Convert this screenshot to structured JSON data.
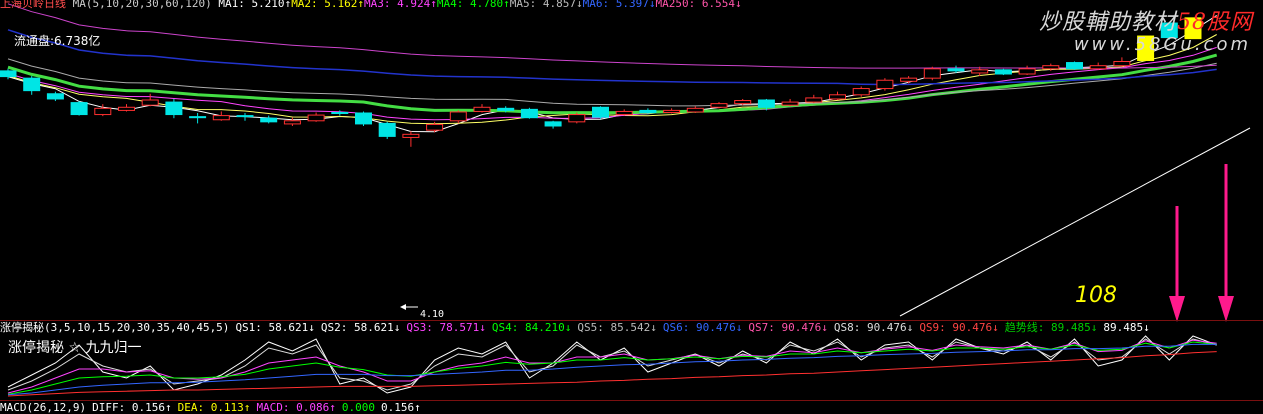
{
  "header": {
    "stock_title": "上海贝岭日线",
    "ma_params": "MA(5,10,20,30,60,120)",
    "ma_values": [
      {
        "label": "MA1: 5.210↑",
        "color": "#ffffff"
      },
      {
        "label": "MA2: 5.162↑",
        "color": "#ffff00"
      },
      {
        "label": "MA3: 4.924↑",
        "color": "#ff44ff"
      },
      {
        "label": "MA4: 4.780↑",
        "color": "#00ff00"
      },
      {
        "label": "MA5: 4.857↓",
        "color": "#bbbbbb"
      },
      {
        "label": "MA6: 5.397↓",
        "color": "#3366ff"
      },
      {
        "label": "MA250: 6.554↓",
        "color": "#ff55aa"
      }
    ]
  },
  "float_share": "流通盘:6.738亿",
  "low_label": "4.10",
  "annotation": "108",
  "watermark": {
    "line1_prefix": "炒股輔助教材",
    "line1_brand": "58股网",
    "line2": "www.58Gu.com"
  },
  "indicator": {
    "title": "涨停揭秘(3,5,10,15,20,30,35,40,45,5)",
    "values": [
      {
        "label": "QS1: 58.621↓",
        "color": "#ffffff"
      },
      {
        "label": "QS2: 58.621↓",
        "color": "#ffffff"
      },
      {
        "label": "QS3: 78.571↓",
        "color": "#ff44ff"
      },
      {
        "label": "QS4: 84.210↓",
        "color": "#00ff00"
      },
      {
        "label": "QS5: 85.542↓",
        "color": "#bbbbbb"
      },
      {
        "label": "QS6: 90.476↓",
        "color": "#3366ff"
      },
      {
        "label": "QS7: 90.476↓",
        "color": "#ff55aa"
      },
      {
        "label": "QS8: 90.476↓",
        "color": "#dddddd"
      },
      {
        "label": "QS9: 90.476↓",
        "color": "#ff4444"
      },
      {
        "label": "趋势线: 89.485↓",
        "color": "#00cc00"
      },
      {
        "label": "89.485↓",
        "color": "#ffffff"
      }
    ],
    "subtitle": "涨停揭秘 ☆ 九九归一"
  },
  "macd": {
    "params": "MACD(26,12,9)",
    "values": [
      {
        "label": "DIFF: 0.156↑",
        "color": "#ffffff"
      },
      {
        "label": "DEA: 0.113↑",
        "color": "#ffff00"
      },
      {
        "label": "MACD: 0.086↑",
        "color": "#ff44ff"
      },
      {
        "label": "0.000",
        "color": "#00ff00"
      },
      {
        "label": "0.156↑",
        "color": "#ffffff"
      }
    ]
  },
  "colors": {
    "up": "#ff3030",
    "down": "#00e5e5",
    "limit_up": "#ffff00",
    "arrow": "#ff1a8c"
  },
  "candles": [
    {
      "o": 5.56,
      "c": 5.45,
      "h": 5.6,
      "l": 5.4
    },
    {
      "o": 5.42,
      "c": 5.18,
      "h": 5.46,
      "l": 5.1
    },
    {
      "o": 5.12,
      "c": 5.02,
      "h": 5.16,
      "l": 4.98
    },
    {
      "o": 4.95,
      "c": 4.72,
      "h": 4.98,
      "l": 4.7
    },
    {
      "o": 4.72,
      "c": 4.84,
      "h": 4.92,
      "l": 4.69
    },
    {
      "o": 4.8,
      "c": 4.86,
      "h": 4.92,
      "l": 4.78
    },
    {
      "o": 4.9,
      "c": 5.0,
      "h": 5.12,
      "l": 4.88
    },
    {
      "o": 4.96,
      "c": 4.72,
      "h": 5.02,
      "l": 4.65
    },
    {
      "o": 4.68,
      "c": 4.66,
      "h": 4.75,
      "l": 4.55
    },
    {
      "o": 4.62,
      "c": 4.7,
      "h": 4.78,
      "l": 4.6
    },
    {
      "o": 4.7,
      "c": 4.68,
      "h": 4.75,
      "l": 4.6
    },
    {
      "o": 4.65,
      "c": 4.58,
      "h": 4.7,
      "l": 4.55
    },
    {
      "o": 4.54,
      "c": 4.6,
      "h": 4.66,
      "l": 4.5
    },
    {
      "o": 4.6,
      "c": 4.71,
      "h": 4.76,
      "l": 4.58
    },
    {
      "o": 4.76,
      "c": 4.74,
      "h": 4.8,
      "l": 4.7
    },
    {
      "o": 4.75,
      "c": 4.54,
      "h": 4.78,
      "l": 4.5
    },
    {
      "o": 4.55,
      "c": 4.3,
      "h": 4.58,
      "l": 4.25
    },
    {
      "o": 4.28,
      "c": 4.34,
      "h": 4.4,
      "l": 4.1
    },
    {
      "o": 4.42,
      "c": 4.53,
      "h": 4.58,
      "l": 4.38
    },
    {
      "o": 4.6,
      "c": 4.77,
      "h": 4.8,
      "l": 4.55
    },
    {
      "o": 4.78,
      "c": 4.86,
      "h": 4.92,
      "l": 4.76
    },
    {
      "o": 4.84,
      "c": 4.8,
      "h": 4.88,
      "l": 4.76
    },
    {
      "o": 4.82,
      "c": 4.66,
      "h": 4.85,
      "l": 4.64
    },
    {
      "o": 4.58,
      "c": 4.5,
      "h": 4.6,
      "l": 4.45
    },
    {
      "o": 4.58,
      "c": 4.72,
      "h": 4.76,
      "l": 4.55
    },
    {
      "o": 4.86,
      "c": 4.67,
      "h": 4.88,
      "l": 4.64
    },
    {
      "o": 4.72,
      "c": 4.78,
      "h": 4.82,
      "l": 4.7
    },
    {
      "o": 4.8,
      "c": 4.76,
      "h": 4.84,
      "l": 4.74
    },
    {
      "o": 4.76,
      "c": 4.8,
      "h": 4.84,
      "l": 4.74
    },
    {
      "o": 4.77,
      "c": 4.84,
      "h": 4.88,
      "l": 4.75
    },
    {
      "o": 4.86,
      "c": 4.93,
      "h": 4.96,
      "l": 4.84
    },
    {
      "o": 4.93,
      "c": 4.99,
      "h": 5.02,
      "l": 4.9
    },
    {
      "o": 5.0,
      "c": 4.86,
      "h": 5.02,
      "l": 4.8
    },
    {
      "o": 4.9,
      "c": 4.96,
      "h": 5.02,
      "l": 4.88
    },
    {
      "o": 4.96,
      "c": 5.04,
      "h": 5.1,
      "l": 4.94
    },
    {
      "o": 5.02,
      "c": 5.1,
      "h": 5.16,
      "l": 5.0
    },
    {
      "o": 5.1,
      "c": 5.22,
      "h": 5.26,
      "l": 5.06
    },
    {
      "o": 5.22,
      "c": 5.38,
      "h": 5.42,
      "l": 5.18
    },
    {
      "o": 5.36,
      "c": 5.42,
      "h": 5.46,
      "l": 5.32
    },
    {
      "o": 5.42,
      "c": 5.6,
      "h": 5.64,
      "l": 5.38
    },
    {
      "o": 5.6,
      "c": 5.56,
      "h": 5.66,
      "l": 5.52
    },
    {
      "o": 5.52,
      "c": 5.58,
      "h": 5.64,
      "l": 5.46
    },
    {
      "o": 5.58,
      "c": 5.5,
      "h": 5.6,
      "l": 5.48
    },
    {
      "o": 5.5,
      "c": 5.6,
      "h": 5.66,
      "l": 5.48
    },
    {
      "o": 5.6,
      "c": 5.66,
      "h": 5.7,
      "l": 5.56
    },
    {
      "o": 5.72,
      "c": 5.6,
      "h": 5.74,
      "l": 5.58
    },
    {
      "o": 5.6,
      "c": 5.66,
      "h": 5.72,
      "l": 5.58
    },
    {
      "o": 5.66,
      "c": 5.74,
      "h": 5.82,
      "l": 5.64
    },
    {
      "o": 5.76,
      "c": 6.23,
      "h": 6.23,
      "l": 5.76,
      "limit": true
    },
    {
      "o": 6.48,
      "c": 6.2,
      "h": 6.5,
      "l": 6.16
    },
    {
      "o": 6.18,
      "c": 6.58,
      "h": 6.58,
      "l": 6.18,
      "limit": true
    },
    {
      "o": 7.02,
      "c": 7.1,
      "h": 7.14,
      "l": 6.98
    }
  ],
  "indicator_lines": [
    {
      "color": "#ffffff",
      "values": [
        0.15,
        0.35,
        0.55,
        0.85,
        0.4,
        0.3,
        0.5,
        0.1,
        0.2,
        0.35,
        0.6,
        0.9,
        0.75,
        0.95,
        0.2,
        0.3,
        0.05,
        0.15,
        0.6,
        0.8,
        0.7,
        0.9,
        0.3,
        0.55,
        0.9,
        0.6,
        0.8,
        0.4,
        0.55,
        0.7,
        0.5,
        0.75,
        0.55,
        0.9,
        0.7,
        0.95,
        0.6,
        0.85,
        0.9,
        0.6,
        0.95,
        0.8,
        0.7,
        0.9,
        0.6,
        0.95,
        0.5,
        0.6,
        1.0,
        0.6,
        1.0,
        0.85
      ]
    },
    {
      "color": "#dddddd",
      "values": [
        0.1,
        0.25,
        0.45,
        0.7,
        0.5,
        0.4,
        0.45,
        0.2,
        0.25,
        0.3,
        0.5,
        0.8,
        0.7,
        0.85,
        0.3,
        0.25,
        0.1,
        0.2,
        0.5,
        0.7,
        0.65,
        0.85,
        0.4,
        0.5,
        0.85,
        0.65,
        0.75,
        0.5,
        0.6,
        0.7,
        0.55,
        0.7,
        0.6,
        0.85,
        0.75,
        0.9,
        0.65,
        0.8,
        0.85,
        0.65,
        0.9,
        0.8,
        0.75,
        0.85,
        0.65,
        0.9,
        0.6,
        0.65,
        0.95,
        0.7,
        0.95,
        0.85
      ]
    },
    {
      "color": "#ff44ff",
      "values": [
        0.05,
        0.15,
        0.3,
        0.45,
        0.45,
        0.4,
        0.42,
        0.3,
        0.28,
        0.3,
        0.4,
        0.55,
        0.6,
        0.65,
        0.5,
        0.4,
        0.25,
        0.25,
        0.4,
        0.5,
        0.55,
        0.65,
        0.55,
        0.55,
        0.65,
        0.65,
        0.7,
        0.6,
        0.62,
        0.68,
        0.62,
        0.68,
        0.66,
        0.75,
        0.72,
        0.8,
        0.72,
        0.78,
        0.82,
        0.76,
        0.85,
        0.82,
        0.8,
        0.85,
        0.78,
        0.88,
        0.74,
        0.76,
        0.92,
        0.8,
        0.93,
        0.88
      ]
    },
    {
      "color": "#00ff00",
      "values": [
        0.03,
        0.1,
        0.2,
        0.3,
        0.32,
        0.33,
        0.35,
        0.3,
        0.3,
        0.32,
        0.36,
        0.45,
        0.5,
        0.55,
        0.48,
        0.44,
        0.35,
        0.33,
        0.4,
        0.46,
        0.5,
        0.56,
        0.53,
        0.55,
        0.6,
        0.6,
        0.64,
        0.6,
        0.62,
        0.65,
        0.62,
        0.66,
        0.65,
        0.7,
        0.7,
        0.75,
        0.72,
        0.75,
        0.78,
        0.75,
        0.8,
        0.8,
        0.78,
        0.82,
        0.78,
        0.85,
        0.76,
        0.78,
        0.88,
        0.8,
        0.9,
        0.86
      ]
    },
    {
      "color": "#3366ff",
      "values": [
        0.02,
        0.05,
        0.1,
        0.15,
        0.18,
        0.2,
        0.22,
        0.22,
        0.23,
        0.25,
        0.27,
        0.3,
        0.33,
        0.36,
        0.36,
        0.36,
        0.34,
        0.34,
        0.36,
        0.38,
        0.4,
        0.43,
        0.43,
        0.45,
        0.48,
        0.5,
        0.52,
        0.53,
        0.55,
        0.57,
        0.58,
        0.6,
        0.61,
        0.63,
        0.64,
        0.66,
        0.67,
        0.69,
        0.7,
        0.71,
        0.73,
        0.74,
        0.75,
        0.77,
        0.77,
        0.79,
        0.79,
        0.8,
        0.83,
        0.83,
        0.86,
        0.86
      ]
    },
    {
      "color": "#ff3030",
      "values": [
        0.0,
        0.02,
        0.04,
        0.06,
        0.07,
        0.08,
        0.09,
        0.1,
        0.1,
        0.11,
        0.12,
        0.13,
        0.14,
        0.15,
        0.16,
        0.16,
        0.16,
        0.16,
        0.17,
        0.18,
        0.19,
        0.2,
        0.21,
        0.22,
        0.23,
        0.25,
        0.26,
        0.28,
        0.29,
        0.31,
        0.32,
        0.34,
        0.35,
        0.37,
        0.38,
        0.4,
        0.42,
        0.44,
        0.46,
        0.48,
        0.5,
        0.52,
        0.54,
        0.56,
        0.58,
        0.6,
        0.62,
        0.64,
        0.67,
        0.69,
        0.72,
        0.74
      ]
    }
  ]
}
